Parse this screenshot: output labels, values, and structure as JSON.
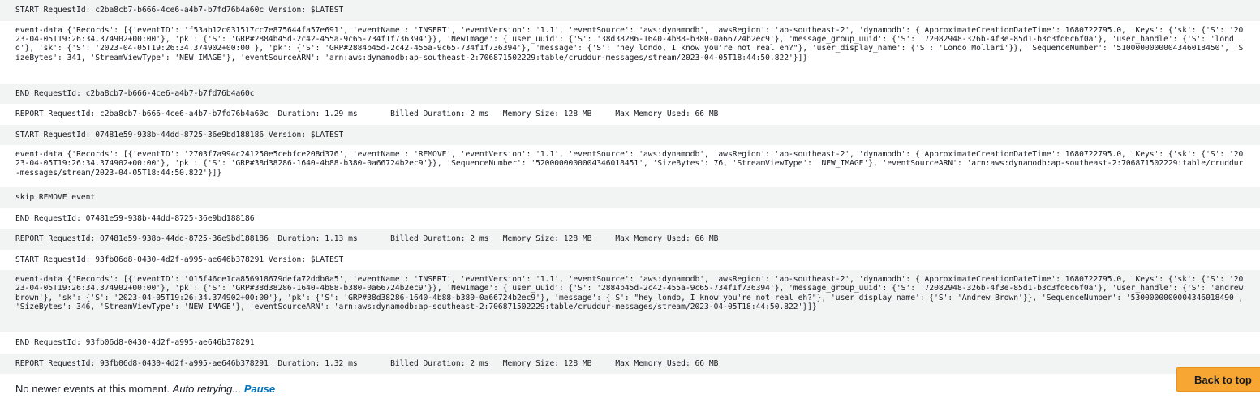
{
  "log_rows": [
    "START RequestId: c2ba8cb7-b666-4ce6-a4b7-b7fd76b4a60c Version: $LATEST",
    "event-data {'Records': [{'eventID': 'f53ab12c031517cc7e875644fa57e691', 'eventName': 'INSERT', 'eventVersion': '1.1', 'eventSource': 'aws:dynamodb', 'awsRegion': 'ap-southeast-2', 'dynamodb': {'ApproximateCreationDateTime': 1680722795.0, 'Keys': {'sk': {'S': '2023-04-05T19:26:34.374902+00:00'}, 'pk': {'S': 'GRP#2884b45d-2c42-455a-9c65-734f1f736394'}}, 'NewImage': {'user_uuid': {'S': '38d38286-1640-4b88-b380-0a66724b2ec9'}, 'message_group_uuid': {'S': '72082948-326b-4f3e-85d1-b3c3fd6c6f0a'}, 'user_handle': {'S': 'londo'}, 'sk': {'S': '2023-04-05T19:26:34.374902+00:00'}, 'pk': {'S': 'GRP#2884b45d-2c42-455a-9c65-734f1f736394'}, 'message': {'S': \"hey londo, I know you're not real eh?\"}, 'user_display_name': {'S': 'Londo Mollari'}}, 'SequenceNumber': '5100000000004346018450', 'SizeBytes': 341, 'StreamViewType': 'NEW_IMAGE'}, 'eventSourceARN': 'arn:aws:dynamodb:ap-southeast-2:706871502229:table/cruddur-messages/stream/2023-04-05T18:44:50.822'}]}",
    "END RequestId: c2ba8cb7-b666-4ce6-a4b7-b7fd76b4a60c",
    "REPORT RequestId: c2ba8cb7-b666-4ce6-a4b7-b7fd76b4a60c  Duration: 1.29 ms       Billed Duration: 2 ms   Memory Size: 128 MB     Max Memory Used: 66 MB",
    "START RequestId: 07481e59-938b-44dd-8725-36e9bd188186 Version: $LATEST",
    "event-data {'Records': [{'eventID': '2703f7a994c241250e5cebfce208d376', 'eventName': 'REMOVE', 'eventVersion': '1.1', 'eventSource': 'aws:dynamodb', 'awsRegion': 'ap-southeast-2', 'dynamodb': {'ApproximateCreationDateTime': 1680722795.0, 'Keys': {'sk': {'S': '2023-04-05T19:26:34.374902+00:00'}, 'pk': {'S': 'GRP#38d38286-1640-4b88-b380-0a66724b2ec9'}}, 'SequenceNumber': '5200000000004346018451', 'SizeBytes': 76, 'StreamViewType': 'NEW_IMAGE'}, 'eventSourceARN': 'arn:aws:dynamodb:ap-southeast-2:706871502229:table/cruddur-messages/stream/2023-04-05T18:44:50.822'}]}",
    "skip REMOVE event",
    "END RequestId: 07481e59-938b-44dd-8725-36e9bd188186",
    "REPORT RequestId: 07481e59-938b-44dd-8725-36e9bd188186  Duration: 1.13 ms       Billed Duration: 2 ms   Memory Size: 128 MB     Max Memory Used: 66 MB",
    "START RequestId: 93fb06d8-0430-4d2f-a995-ae646b378291 Version: $LATEST",
    "event-data {'Records': [{'eventID': '015f46ce1ca856918679defa72ddb0a5', 'eventName': 'INSERT', 'eventVersion': '1.1', 'eventSource': 'aws:dynamodb', 'awsRegion': 'ap-southeast-2', 'dynamodb': {'ApproximateCreationDateTime': 1680722795.0, 'Keys': {'sk': {'S': '2023-04-05T19:26:34.374902+00:00'}, 'pk': {'S': 'GRP#38d38286-1640-4b88-b380-0a66724b2ec9'}}, 'NewImage': {'user_uuid': {'S': '2884b45d-2c42-455a-9c65-734f1f736394'}, 'message_group_uuid': {'S': '72082948-326b-4f3e-85d1-b3c3fd6c6f0a'}, 'user_handle': {'S': 'andrewbrown'}, 'sk': {'S': '2023-04-05T19:26:34.374902+00:00'}, 'pk': {'S': 'GRP#38d38286-1640-4b88-b380-0a66724b2ec9'}, 'message': {'S': \"hey londo, I know you're not real eh?\"}, 'user_display_name': {'S': 'Andrew Brown'}}, 'SequenceNumber': '5300000000004346018490', 'SizeBytes': 346, 'StreamViewType': 'NEW_IMAGE'}, 'eventSourceARN': 'arn:aws:dynamodb:ap-southeast-2:706871502229:table/cruddur-messages/stream/2023-04-05T18:44:50.822'}]}",
    "END RequestId: 93fb06d8-0430-4d2f-a995-ae646b378291",
    "REPORT RequestId: 93fb06d8-0430-4d2f-a995-ae646b378291  Duration: 1.32 ms       Billed Duration: 2 ms   Memory Size: 128 MB     Max Memory Used: 66 MB"
  ],
  "footer": {
    "status_text": "No newer events at this moment. ",
    "retry_text": "Auto retrying... ",
    "pause_label": "Pause"
  },
  "back_to_top_label": "Back to top",
  "colors": {
    "row_alt_bg": "#f2f3f3",
    "link": "#0073bb",
    "button_bg": "#f7a634"
  }
}
